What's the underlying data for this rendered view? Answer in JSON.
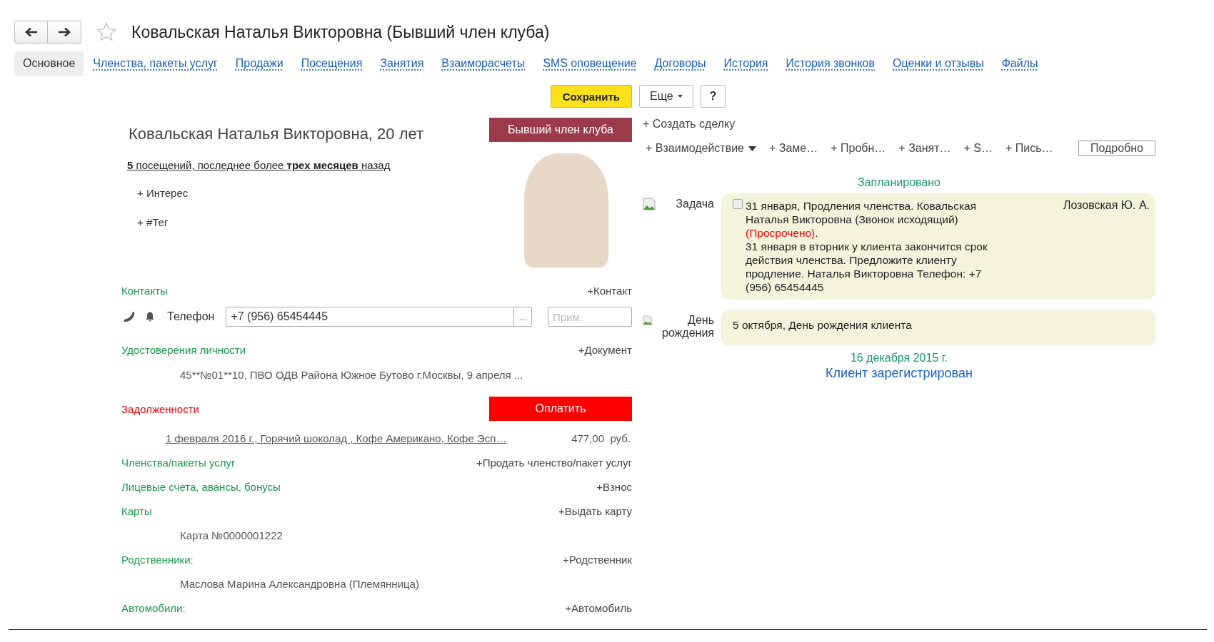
{
  "window": {
    "title": "Ковальская Наталья Викторовна (Бывший член клуба)",
    "favorite": false
  },
  "tabs": [
    {
      "label": "Основное",
      "selected": true
    },
    {
      "label": "Членства, пакеты услуг",
      "selected": false
    },
    {
      "label": "Продажи",
      "selected": false
    },
    {
      "label": "Посещения",
      "selected": false
    },
    {
      "label": "Занятия",
      "selected": false
    },
    {
      "label": "Взаиморасчеты",
      "selected": false
    },
    {
      "label": "SMS оповещение",
      "selected": false
    },
    {
      "label": "Договоры",
      "selected": false
    },
    {
      "label": "История",
      "selected": false
    },
    {
      "label": "История звонков",
      "selected": false
    },
    {
      "label": "Оценки и отзывы",
      "selected": false
    },
    {
      "label": "Файлы",
      "selected": false
    }
  ],
  "toolbar": {
    "save": "Сохранить",
    "more": "Еще",
    "help": "?"
  },
  "client": {
    "name": "Ковальская Наталья Викторовна, 20 лет",
    "status": "Бывший член клуба",
    "visits": "**5** посещений, последнее более **трех месяцев** назад",
    "interest": "+ Интерес",
    "tag": "+ #Тег"
  },
  "contacts": {
    "title": "Контакты",
    "add": "+Контакт",
    "label": "Телефон",
    "value": "+7 (956) 65454445",
    "more": "...",
    "note_placeholder": "Прим."
  },
  "documents": {
    "title": "Удостоверения личности",
    "add": "+Документ",
    "value": "45**№01**10, ПВО ОДВ Района Южное Бутово г.Москвы, 9 апреля ..."
  },
  "debts": {
    "title": "Задолженности",
    "pay": "Оплатить",
    "item": "1 февраля 2016 г., Горячий шоколад , Кофе Американо, Кофе Эсп…",
    "amount": "477,00  руб."
  },
  "sections": [
    {
      "title": "Членства/пакеты услуг",
      "add": "+Продать членство/пакет услуг"
    },
    {
      "title": "Лицевые счета, авансы, бонусы",
      "add": "+Взнос"
    },
    {
      "title": "Карты",
      "add": "+Выдать карту",
      "value": "Карта №0000001222"
    },
    {
      "title": "Родственники:",
      "add": "+Родственник",
      "value": "Маслова Марина Александровна (Племянница)"
    },
    {
      "title": "Автомобили:",
      "add": "+Автомобиль"
    }
  ],
  "actions": {
    "create_deal": "+ Создать сделку",
    "items": [
      {
        "label": "+ Взаимодействие",
        "dropdown": true
      },
      {
        "label": "+ Заме…",
        "dropdown": false
      },
      {
        "label": "+ Пробн…",
        "dropdown": false
      },
      {
        "label": "+ Занят…",
        "dropdown": false
      },
      {
        "label": "+ S…",
        "dropdown": false
      },
      {
        "label": "+ Пись…",
        "dropdown": false
      }
    ],
    "details": "Подробно"
  },
  "timeline": {
    "planned_title": "Запланировано",
    "events": [
      {
        "kind": "task",
        "label": "Задача",
        "checked": false,
        "text": "31 января, Продления членства. Ковальская Наталья Викторовна (Звонок исходящий)",
        "status": "(Просрочено)",
        "status_end": ".",
        "description": "31 января в вторник у клиента закончится срок действия членства. Предложите клиенту продление. Наталья Викторовна Телефон: +7 (956) 65454445",
        "author": "Лозовская Ю. А."
      },
      {
        "kind": "birthday",
        "label": "День рождения",
        "text": "5 октября, День рождения клиента"
      }
    ],
    "registered_date": "16 декабря 2015 г.",
    "registered_text": "Клиент зарегистрирован"
  }
}
